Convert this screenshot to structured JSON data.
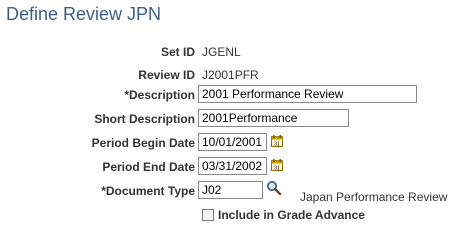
{
  "page": {
    "title": "Define Review JPN"
  },
  "form": {
    "set_id": {
      "label": "Set ID",
      "value": "JGENL"
    },
    "review_id": {
      "label": "Review ID",
      "value": "J2001PFR"
    },
    "description": {
      "label": "*Description",
      "value": "2001 Performance Review"
    },
    "short_description": {
      "label": "Short Description",
      "value": "2001Performance"
    },
    "period_begin_date": {
      "label": "Period Begin Date",
      "value": "10/01/2001",
      "icon": "calendar-icon"
    },
    "period_end_date": {
      "label": "Period End Date",
      "value": "03/31/2002",
      "icon": "calendar-icon"
    },
    "document_type": {
      "label": "*Document Type",
      "value": "J02",
      "icon": "magnifier-lookup-icon",
      "description": "Japan Performance Review"
    },
    "include_in_grade_advance": {
      "label": "Include in Grade Advance",
      "checked": false
    }
  },
  "colors": {
    "title": "#3c5e85",
    "label": "#333333",
    "field_border": "#8a8a8a",
    "calendar_accent": "#c8a000"
  }
}
